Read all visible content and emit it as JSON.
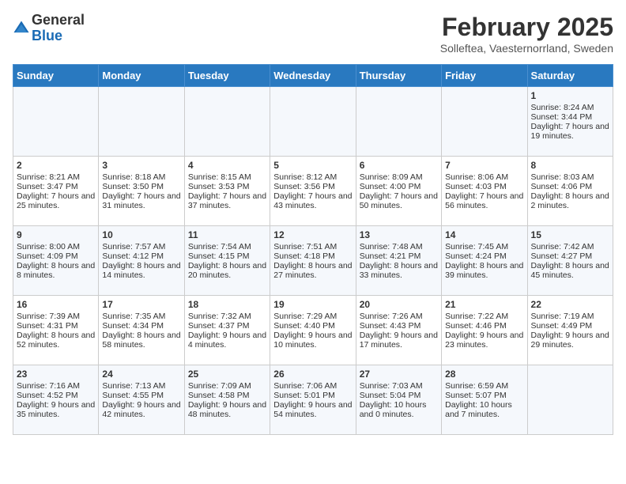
{
  "header": {
    "logo_general": "General",
    "logo_blue": "Blue",
    "month_title": "February 2025",
    "subtitle": "Solleftea, Vaesternorrland, Sweden"
  },
  "days_of_week": [
    "Sunday",
    "Monday",
    "Tuesday",
    "Wednesday",
    "Thursday",
    "Friday",
    "Saturday"
  ],
  "weeks": [
    [
      {
        "day": "",
        "text": ""
      },
      {
        "day": "",
        "text": ""
      },
      {
        "day": "",
        "text": ""
      },
      {
        "day": "",
        "text": ""
      },
      {
        "day": "",
        "text": ""
      },
      {
        "day": "",
        "text": ""
      },
      {
        "day": "1",
        "text": "Sunrise: 8:24 AM\nSunset: 3:44 PM\nDaylight: 7 hours and 19 minutes."
      }
    ],
    [
      {
        "day": "2",
        "text": "Sunrise: 8:21 AM\nSunset: 3:47 PM\nDaylight: 7 hours and 25 minutes."
      },
      {
        "day": "3",
        "text": "Sunrise: 8:18 AM\nSunset: 3:50 PM\nDaylight: 7 hours and 31 minutes."
      },
      {
        "day": "4",
        "text": "Sunrise: 8:15 AM\nSunset: 3:53 PM\nDaylight: 7 hours and 37 minutes."
      },
      {
        "day": "5",
        "text": "Sunrise: 8:12 AM\nSunset: 3:56 PM\nDaylight: 7 hours and 43 minutes."
      },
      {
        "day": "6",
        "text": "Sunrise: 8:09 AM\nSunset: 4:00 PM\nDaylight: 7 hours and 50 minutes."
      },
      {
        "day": "7",
        "text": "Sunrise: 8:06 AM\nSunset: 4:03 PM\nDaylight: 7 hours and 56 minutes."
      },
      {
        "day": "8",
        "text": "Sunrise: 8:03 AM\nSunset: 4:06 PM\nDaylight: 8 hours and 2 minutes."
      }
    ],
    [
      {
        "day": "9",
        "text": "Sunrise: 8:00 AM\nSunset: 4:09 PM\nDaylight: 8 hours and 8 minutes."
      },
      {
        "day": "10",
        "text": "Sunrise: 7:57 AM\nSunset: 4:12 PM\nDaylight: 8 hours and 14 minutes."
      },
      {
        "day": "11",
        "text": "Sunrise: 7:54 AM\nSunset: 4:15 PM\nDaylight: 8 hours and 20 minutes."
      },
      {
        "day": "12",
        "text": "Sunrise: 7:51 AM\nSunset: 4:18 PM\nDaylight: 8 hours and 27 minutes."
      },
      {
        "day": "13",
        "text": "Sunrise: 7:48 AM\nSunset: 4:21 PM\nDaylight: 8 hours and 33 minutes."
      },
      {
        "day": "14",
        "text": "Sunrise: 7:45 AM\nSunset: 4:24 PM\nDaylight: 8 hours and 39 minutes."
      },
      {
        "day": "15",
        "text": "Sunrise: 7:42 AM\nSunset: 4:27 PM\nDaylight: 8 hours and 45 minutes."
      }
    ],
    [
      {
        "day": "16",
        "text": "Sunrise: 7:39 AM\nSunset: 4:31 PM\nDaylight: 8 hours and 52 minutes."
      },
      {
        "day": "17",
        "text": "Sunrise: 7:35 AM\nSunset: 4:34 PM\nDaylight: 8 hours and 58 minutes."
      },
      {
        "day": "18",
        "text": "Sunrise: 7:32 AM\nSunset: 4:37 PM\nDaylight: 9 hours and 4 minutes."
      },
      {
        "day": "19",
        "text": "Sunrise: 7:29 AM\nSunset: 4:40 PM\nDaylight: 9 hours and 10 minutes."
      },
      {
        "day": "20",
        "text": "Sunrise: 7:26 AM\nSunset: 4:43 PM\nDaylight: 9 hours and 17 minutes."
      },
      {
        "day": "21",
        "text": "Sunrise: 7:22 AM\nSunset: 4:46 PM\nDaylight: 9 hours and 23 minutes."
      },
      {
        "day": "22",
        "text": "Sunrise: 7:19 AM\nSunset: 4:49 PM\nDaylight: 9 hours and 29 minutes."
      }
    ],
    [
      {
        "day": "23",
        "text": "Sunrise: 7:16 AM\nSunset: 4:52 PM\nDaylight: 9 hours and 35 minutes."
      },
      {
        "day": "24",
        "text": "Sunrise: 7:13 AM\nSunset: 4:55 PM\nDaylight: 9 hours and 42 minutes."
      },
      {
        "day": "25",
        "text": "Sunrise: 7:09 AM\nSunset: 4:58 PM\nDaylight: 9 hours and 48 minutes."
      },
      {
        "day": "26",
        "text": "Sunrise: 7:06 AM\nSunset: 5:01 PM\nDaylight: 9 hours and 54 minutes."
      },
      {
        "day": "27",
        "text": "Sunrise: 7:03 AM\nSunset: 5:04 PM\nDaylight: 10 hours and 0 minutes."
      },
      {
        "day": "28",
        "text": "Sunrise: 6:59 AM\nSunset: 5:07 PM\nDaylight: 10 hours and 7 minutes."
      },
      {
        "day": "",
        "text": ""
      }
    ]
  ]
}
